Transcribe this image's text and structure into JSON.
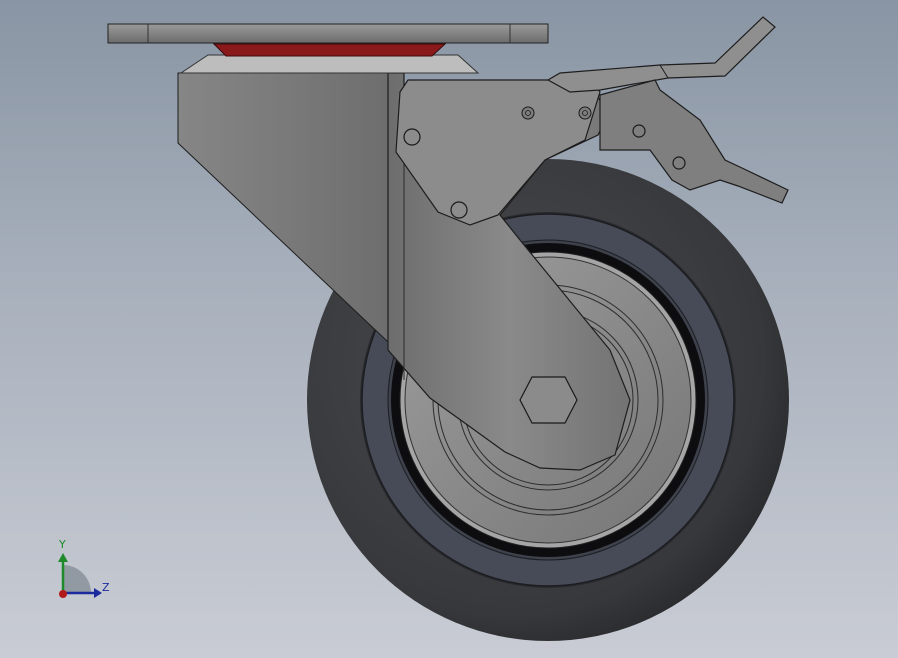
{
  "view": {
    "type": "3d-cad-viewport",
    "subject": "caster-wheel-assembly-side-view",
    "colors": {
      "background_top": "#8995a4",
      "background_bottom": "#c9ccd4",
      "tire": "#3a3b3e",
      "tire_band": "#454a56",
      "rim": "#8e8e8e",
      "bracket": "#7a7a7a",
      "top_plate": "#828282",
      "bearing_red": "#8a1a1a",
      "axis_y": "#1f8a2a",
      "axis_z": "#1b2a9c",
      "axis_x": "#b31b1b"
    }
  },
  "triad": {
    "y_label": "Y",
    "z_label": "Z",
    "icon": "coordinate-triad-icon"
  }
}
